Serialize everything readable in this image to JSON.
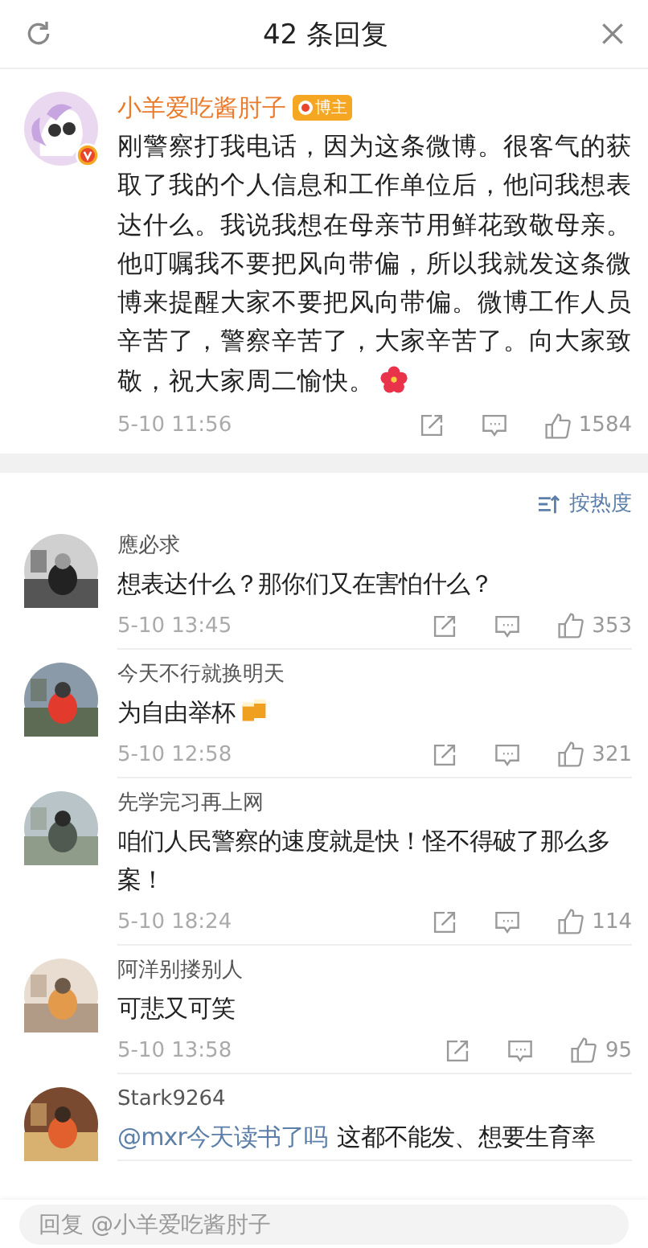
{
  "header": {
    "title": "42 条回复"
  },
  "post": {
    "author": "小羊爱吃酱肘子",
    "badge": "博主",
    "verified": true,
    "text": "刚警察打我电话，因为这条微博。很客气的获取了我的个人信息和工作单位后，他问我想表达什么。我说我想在母亲节用鲜花致敬母亲。他叮嘱我不要把风向带偏，所以我就发这条微博来提醒大家不要把风向带偏。微博工作人员辛苦了，警察辛苦了，大家辛苦了。向大家致敬，祝大家周二愉快。",
    "flower_emoji": true,
    "time": "5-10 11:56",
    "likes": "1584"
  },
  "sort": {
    "label": "按热度"
  },
  "comments": [
    {
      "author": "應必求",
      "text": "想表达什么？那你们又在害怕什么？",
      "time": "5-10 13:45",
      "likes": "353"
    },
    {
      "author": "今天不行就换明天",
      "text": "为自由举杯",
      "beer_emoji": true,
      "time": "5-10 12:58",
      "likes": "321"
    },
    {
      "author": "先学完习再上网",
      "text": "咱们人民警察的速度就是快！怪不得破了那么多案！",
      "time": "5-10 18:24",
      "likes": "114"
    },
    {
      "author": "阿洋别搂别人",
      "text": "可悲又可笑",
      "time": "5-10 13:58",
      "likes": "95"
    },
    {
      "author": "Stark9264",
      "mention": "@mxr今天读书了吗",
      "text": "这都不能发、想要生育率"
    }
  ],
  "reply_field": {
    "placeholder": "回复 @小羊爱吃酱肘子"
  }
}
